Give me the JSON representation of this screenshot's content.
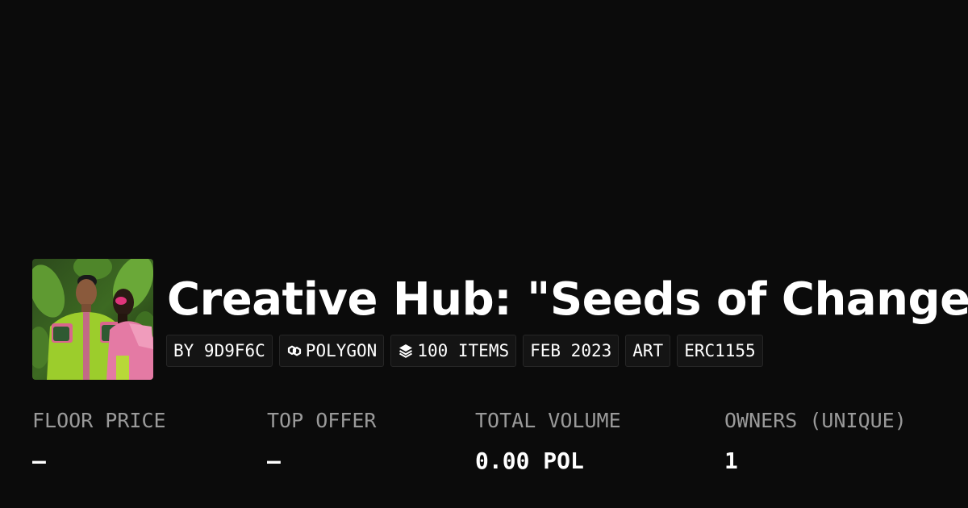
{
  "collection": {
    "title": "Creative Hub: \"Seeds of Change\"",
    "thumbnail_icon": "collection-artwork-image"
  },
  "tags": [
    {
      "label": "BY 9D9F6C"
    },
    {
      "label": "POLYGON",
      "icon": "polygon-chain-icon"
    },
    {
      "label": "100 ITEMS",
      "icon": "layers-icon"
    },
    {
      "label": "FEB 2023"
    },
    {
      "label": "ART"
    },
    {
      "label": "ERC1155"
    }
  ],
  "stats": [
    {
      "label": "FLOOR PRICE",
      "value": "–"
    },
    {
      "label": "TOP OFFER",
      "value": "–"
    },
    {
      "label": "TOTAL VOLUME",
      "value": "0.00 POL"
    },
    {
      "label": "OWNERS (UNIQUE)",
      "value": "1"
    }
  ],
  "colors": {
    "background": "#0b0b0b",
    "text": "#ffffff",
    "muted": "#9a9a9a",
    "tag_bg": "#141414"
  }
}
